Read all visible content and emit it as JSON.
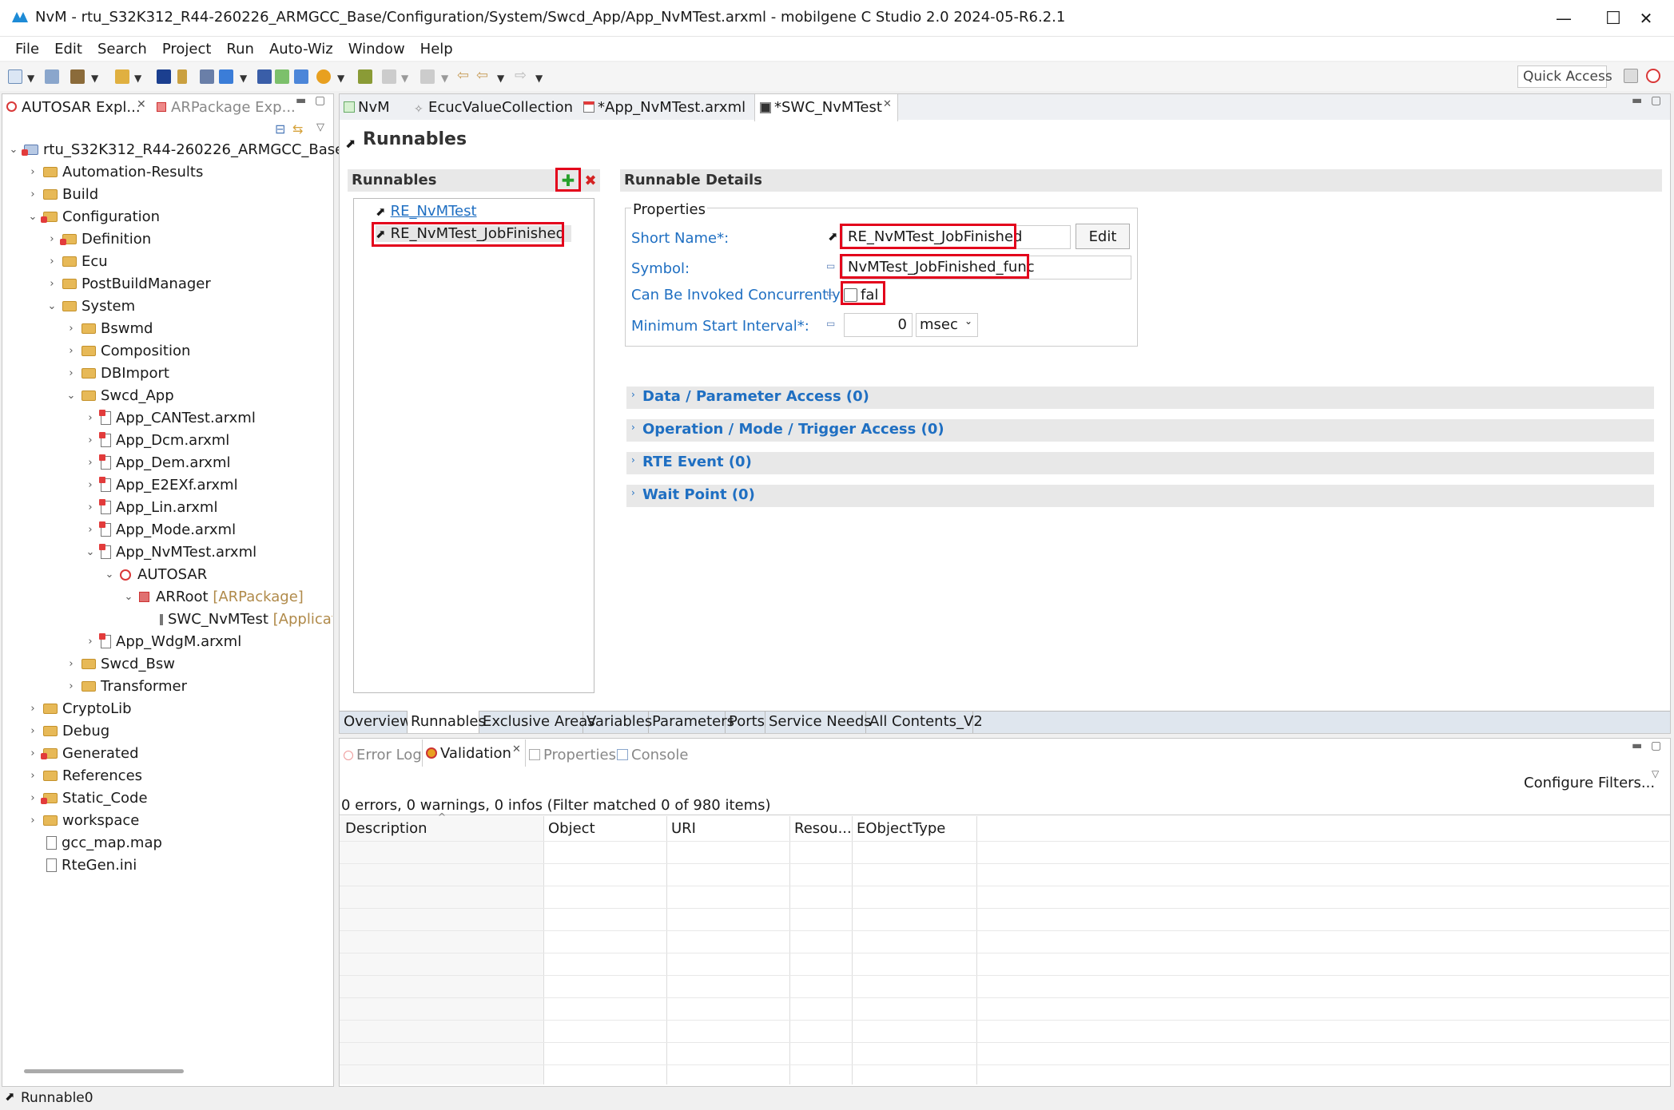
{
  "window": {
    "title": "NvM - rtu_S32K312_R44-260226_ARMGCC_Base/Configuration/System/Swcd_App/App_NvMTest.arxml - mobilgene C Studio 2.0 2024-05-R6.2.1",
    "min": "—",
    "max": "☐",
    "close": "✕"
  },
  "menu": [
    "File",
    "Edit",
    "Search",
    "Project",
    "Run",
    "Auto-Wiz",
    "Window",
    "Help"
  ],
  "quick_access": "Quick Access",
  "left_tabs": {
    "explorer": "AUTOSAR Expl...",
    "package": "ARPackage Exp..."
  },
  "tree": {
    "root": "rtu_S32K312_R44-260226_ARMGCC_Base",
    "items": [
      {
        "label": "Automation-Results"
      },
      {
        "label": "Build"
      },
      {
        "label": "Configuration"
      },
      {
        "label": "Definition"
      },
      {
        "label": "Ecu"
      },
      {
        "label": "PostBuildManager"
      },
      {
        "label": "System"
      },
      {
        "label": "Bswmd"
      },
      {
        "label": "Composition"
      },
      {
        "label": "DBImport"
      },
      {
        "label": "Swcd_App"
      },
      {
        "label": "App_CANTest.arxml"
      },
      {
        "label": "App_Dcm.arxml"
      },
      {
        "label": "App_Dem.arxml"
      },
      {
        "label": "App_E2EXf.arxml"
      },
      {
        "label": "App_Lin.arxml"
      },
      {
        "label": "App_Mode.arxml"
      },
      {
        "label": "App_NvMTest.arxml"
      },
      {
        "label": "AUTOSAR"
      },
      {
        "label": "ARRoot",
        "suffix": "[ARPackage]"
      },
      {
        "label": "SWC_NvMTest",
        "suffix": "[Applicat"
      },
      {
        "label": "App_WdgM.arxml"
      },
      {
        "label": "Swcd_Bsw"
      },
      {
        "label": "Transformer"
      },
      {
        "label": "CryptoLib"
      },
      {
        "label": "Debug"
      },
      {
        "label": "Generated"
      },
      {
        "label": "References"
      },
      {
        "label": "Static_Code"
      },
      {
        "label": "workspace"
      },
      {
        "label": "gcc_map.map"
      },
      {
        "label": "RteGen.ini"
      }
    ]
  },
  "editor_tabs": [
    "NvM",
    "EcucValueCollection",
    "*App_NvMTest.arxml",
    "*SWC_NvMTest"
  ],
  "page_title": "Runnables",
  "runnables": {
    "header": "Runnables",
    "items": [
      "RE_NvMTest",
      "RE_NvMTest_JobFinished"
    ]
  },
  "details": {
    "header": "Runnable Details",
    "properties": "Properties",
    "short_name_label": "Short Name*:",
    "short_name_value": "RE_NvMTest_JobFinished",
    "edit_button": "Edit",
    "symbol_label": "Symbol:",
    "symbol_value": "NvMTest_JobFinished_func",
    "concurrent_label": "Can Be Invoked Concurrently:",
    "concurrent_value": "fal",
    "min_interval_label": "Minimum Start Interval*:",
    "min_interval_value": "0",
    "min_interval_unit": "msec",
    "sections": [
      "Data / Parameter Access (0)",
      "Operation / Mode / Trigger Access (0)",
      "RTE Event (0)",
      "Wait Point (0)"
    ]
  },
  "bottom_tabs": [
    "Overview",
    "Runnables",
    "Exclusive Areas",
    "Variables",
    "Parameters",
    "Ports",
    "Service Needs",
    "All Contents_V2"
  ],
  "view_tabs": [
    "Error Log",
    "Validation",
    "Properties",
    "Console"
  ],
  "configure_filters": "Configure Filters...",
  "validation_summary": "0 errors, 0 warnings, 0 infos (Filter matched 0 of 980 items)",
  "columns": [
    "Description",
    "Object",
    "URI",
    "Resou...",
    "EObjectType"
  ],
  "status": "Runnable0",
  "colors": {
    "highlight": "#e3001b",
    "link": "#1f6fc2",
    "selected_tab": "#ffffff"
  }
}
